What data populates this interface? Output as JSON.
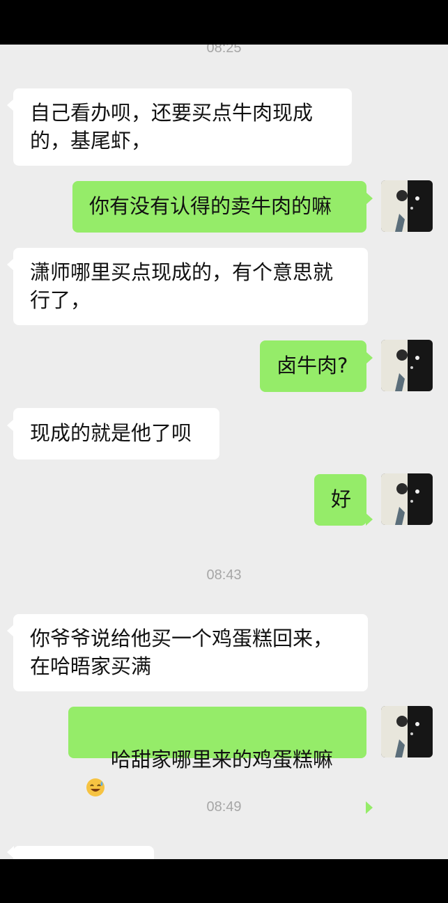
{
  "timestamps": [
    "08:25",
    "08:43",
    "08:49"
  ],
  "messages": [
    {
      "side": "left",
      "text": "自己看办呗，还要买点牛肉现成\n的，基尾虾，"
    },
    {
      "side": "right",
      "text": "你有没有认得的卖牛肉的嘛"
    },
    {
      "side": "left",
      "text": "潇师哪里买点现成的，有个意思就\n行了，"
    },
    {
      "side": "right",
      "text": "卤牛肉?"
    },
    {
      "side": "left",
      "text": "现成的就是他了呗"
    },
    {
      "side": "right",
      "text": "好"
    },
    {
      "side": "left",
      "text": "你爷爷说给他买一个鸡蛋糕回来，\n在哈晤家买满"
    },
    {
      "side": "right",
      "text": "哈甜家哪里来的鸡蛋糕嘛",
      "emoji": "grinning-sweat-emoji"
    }
  ],
  "colors": {
    "background": "#ededed",
    "sent_bubble": "#95ec69",
    "received_bubble": "#ffffff",
    "timestamp": "#a6a6a6"
  },
  "icons": {
    "avatar": "avatar-image"
  }
}
